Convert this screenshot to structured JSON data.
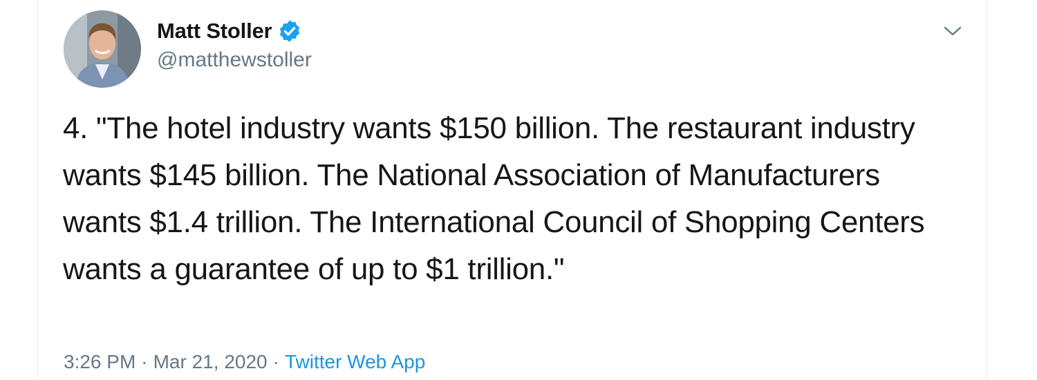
{
  "tweet": {
    "author": {
      "name": "Matt Stoller",
      "handle": "@matthewstoller",
      "verified": true,
      "avatar_icon": "person-avatar"
    },
    "text": "4. \"The hotel industry wants $150 billion. The restaurant industry wants $145 billion. The National Association of Manufacturers wants $1.4 trillion. The International Council of Shopping Centers wants a guarantee of up to $1 trillion.\"",
    "time": "3:26 PM",
    "separator": "·",
    "date": "Mar 21, 2020",
    "source": "Twitter Web App"
  },
  "colors": {
    "text": "#14171a",
    "secondary": "#657786",
    "link": "#1b95e0",
    "verified": "#1da1f2",
    "border": "#e6ecf0"
  },
  "icons": {
    "menu": "chevron-down-icon",
    "verified": "verified-badge-icon"
  }
}
